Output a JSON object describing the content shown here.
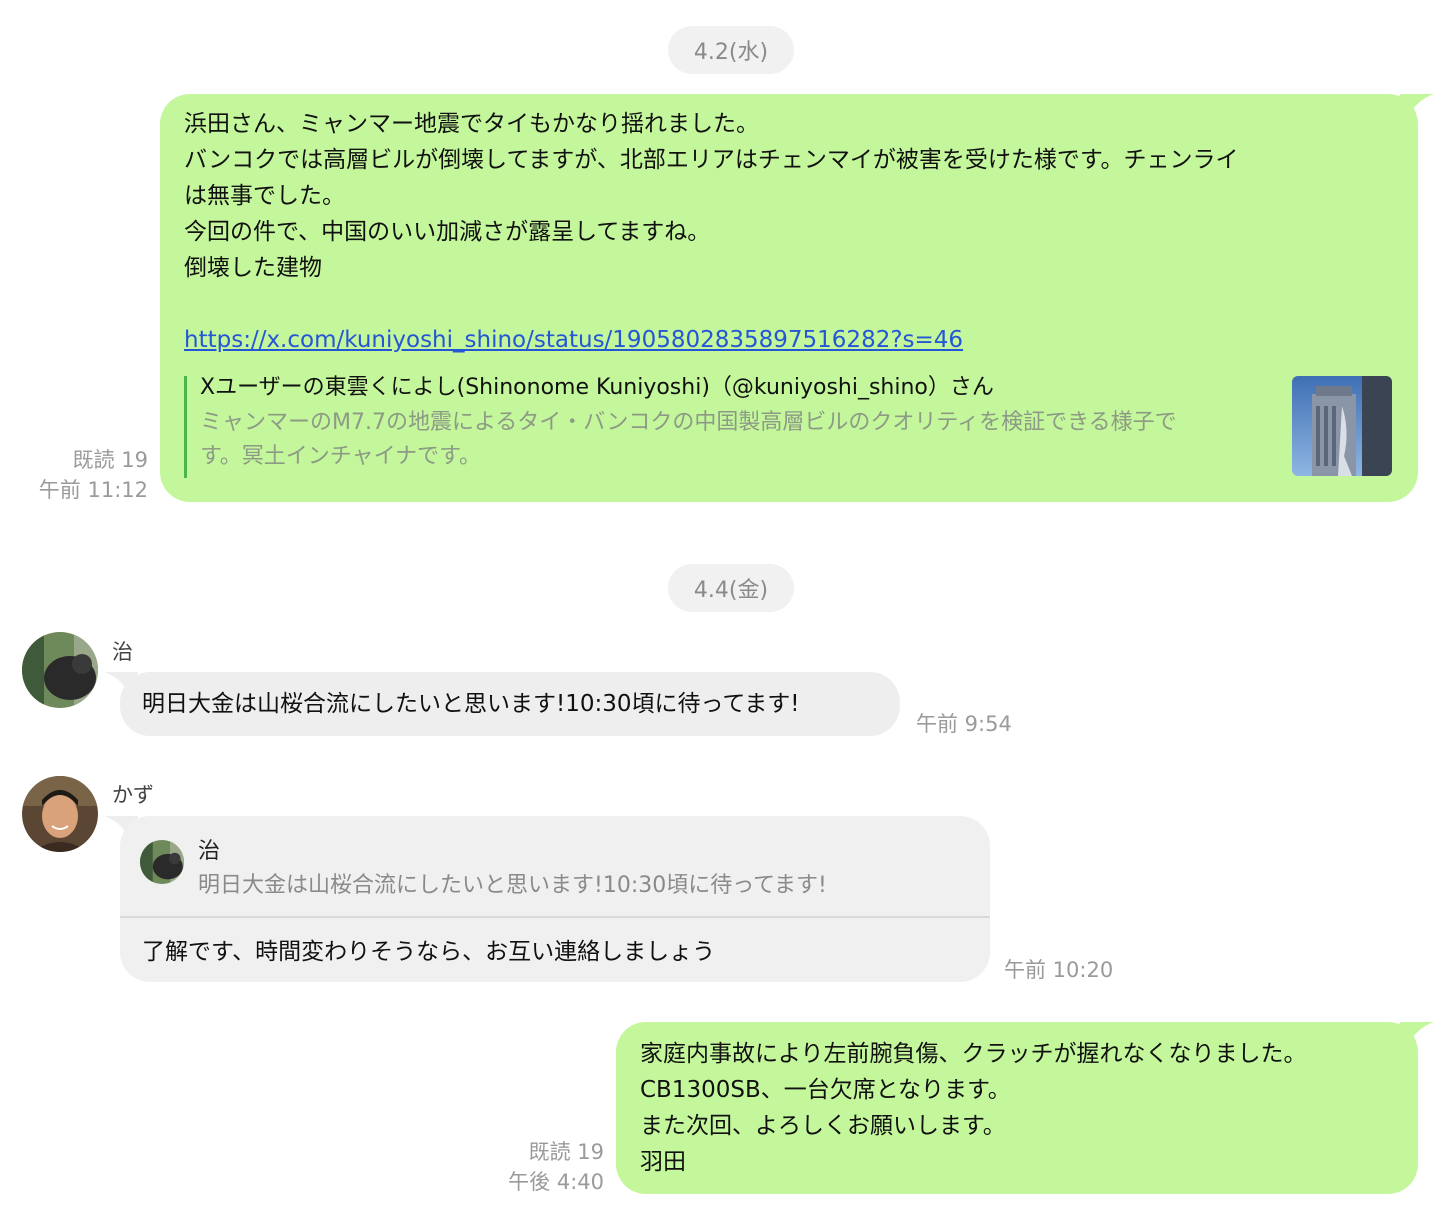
{
  "dates": [
    "4.2(水)",
    "4.4(金)"
  ],
  "messages": {
    "m1": {
      "lines": [
        "浜田さん、ミャンマー地震でタイもかなり揺れました。",
        "バンコクでは高層ビルが倒壊してますが、北部エリアはチェンマイが被害を受けた様です。チェンライ",
        "は無事でした。",
        "今回の件で、中国のいい加減さが露呈してますね。",
        "倒壊した建物"
      ],
      "link": "https://x.com/kuniyoshi_shino/status/1905802835897516282?s=46",
      "preview_title": "Xユーザーの東雲くによし(Shinonome Kuniyoshi)（@kuniyoshi_shino）さん",
      "preview_desc_lines": [
        "ミャンマーのM7.7の地震によるタイ・バンコクの中国製高層ビルのクオリティを検証できる様子で",
        "す。冥土インチャイナです。"
      ],
      "read": "既読 19",
      "time": "午前 11:12"
    },
    "m2": {
      "sender": "治",
      "text": "明日大金は山桜合流にしたいと思います!10:30頃に待ってます!",
      "time": "午前 9:54"
    },
    "m3": {
      "sender": "かず",
      "quote_sender": "治",
      "quote_text": "明日大金は山桜合流にしたいと思います!10:30頃に待ってます!",
      "text": "了解です、時間変わりそうなら、お互い連絡しましょう",
      "time": "午前 10:20"
    },
    "m4": {
      "lines": [
        "家庭内事故により左前腕負傷、クラッチが握れなくなりました。",
        "CB1300SB、一台欠席となります。",
        "また次回、よろしくお願いします。",
        "羽田"
      ],
      "read": "既読 19",
      "time": "午後 4:40"
    }
  },
  "colors": {
    "my_bubble": "#c4f79b",
    "other_bubble": "#eeeeee",
    "link": "#2456d6",
    "meta": "#9a9a9a"
  }
}
